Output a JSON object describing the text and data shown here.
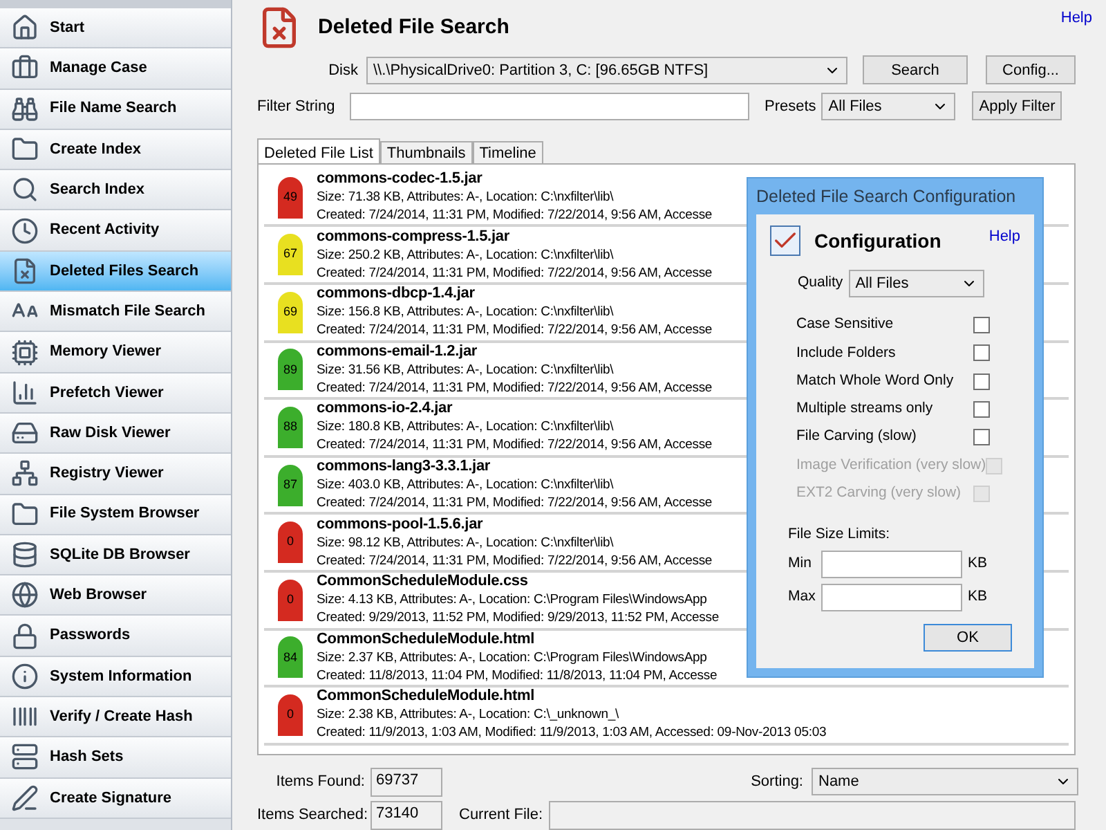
{
  "sidebar": {
    "items": [
      {
        "label": "Start",
        "selected": false
      },
      {
        "label": "Manage Case",
        "selected": false
      },
      {
        "label": "File Name Search",
        "selected": false
      },
      {
        "label": "Create Index",
        "selected": false
      },
      {
        "label": "Search Index",
        "selected": false
      },
      {
        "label": "Recent Activity",
        "selected": false
      },
      {
        "label": "Deleted Files Search",
        "selected": true
      },
      {
        "label": "Mismatch File Search",
        "selected": false
      },
      {
        "label": "Memory Viewer",
        "selected": false
      },
      {
        "label": "Prefetch Viewer",
        "selected": false
      },
      {
        "label": "Raw Disk Viewer",
        "selected": false
      },
      {
        "label": "Registry Viewer",
        "selected": false
      },
      {
        "label": "File System Browser",
        "selected": false
      },
      {
        "label": "SQLite DB Browser",
        "selected": false
      },
      {
        "label": "Web Browser",
        "selected": false
      },
      {
        "label": "Passwords",
        "selected": false
      },
      {
        "label": "System Information",
        "selected": false
      },
      {
        "label": "Verify / Create Hash",
        "selected": false
      },
      {
        "label": "Hash Sets",
        "selected": false
      },
      {
        "label": "Create Signature",
        "selected": false
      }
    ]
  },
  "header": {
    "title": "Deleted File Search",
    "help": "Help"
  },
  "disk": {
    "label": "Disk",
    "value": "\\\\.\\PhysicalDrive0: Partition 3, C: [96.65GB NTFS]"
  },
  "filter": {
    "label": "Filter String"
  },
  "presets": {
    "label": "Presets",
    "value": "All Files"
  },
  "buttons": {
    "search": "Search",
    "config": "Config...",
    "apply": "Apply Filter"
  },
  "tabs": [
    {
      "label": "Deleted File List",
      "selected": true
    },
    {
      "label": "Thumbnails",
      "selected": false
    },
    {
      "label": "Timeline",
      "selected": false
    }
  ],
  "files": [
    {
      "score": "49",
      "color": "#d42a20",
      "name": "commons-codec-1.5.jar",
      "line1": "Size: 71.38 KB, Attributes: A-, Location: C:\\nxfilter\\lib\\",
      "line2": "Created: 7/24/2014, 11:31 PM, Modified: 7/22/2014, 9:56 AM, Accesse"
    },
    {
      "score": "67",
      "color": "#e8e020",
      "name": "commons-compress-1.5.jar",
      "line1": "Size: 250.2 KB, Attributes: A-, Location: C:\\nxfilter\\lib\\",
      "line2": "Created: 7/24/2014, 11:31 PM, Modified: 7/22/2014, 9:56 AM, Accesse"
    },
    {
      "score": "69",
      "color": "#e8e020",
      "name": "commons-dbcp-1.4.jar",
      "line1": "Size: 156.8 KB, Attributes: A-, Location: C:\\nxfilter\\lib\\",
      "line2": "Created: 7/24/2014, 11:31 PM, Modified: 7/22/2014, 9:56 AM, Accesse"
    },
    {
      "score": "89",
      "color": "#3cae2c",
      "name": "commons-email-1.2.jar",
      "line1": "Size: 31.56 KB, Attributes: A-, Location: C:\\nxfilter\\lib\\",
      "line2": "Created: 7/24/2014, 11:31 PM, Modified: 7/22/2014, 9:56 AM, Accesse"
    },
    {
      "score": "88",
      "color": "#3cae2c",
      "name": "commons-io-2.4.jar",
      "line1": "Size: 180.8 KB, Attributes: A-, Location: C:\\nxfilter\\lib\\",
      "line2": "Created: 7/24/2014, 11:31 PM, Modified: 7/22/2014, 9:56 AM, Accesse"
    },
    {
      "score": "87",
      "color": "#3cae2c",
      "name": "commons-lang3-3.3.1.jar",
      "line1": "Size: 403.0 KB, Attributes: A-, Location: C:\\nxfilter\\lib\\",
      "line2": "Created: 7/24/2014, 11:31 PM, Modified: 7/22/2014, 9:56 AM, Accesse"
    },
    {
      "score": "0",
      "color": "#d42a20",
      "name": "commons-pool-1.5.6.jar",
      "line1": "Size: 98.12 KB, Attributes: A-, Location: C:\\nxfilter\\lib\\",
      "line2": "Created: 7/24/2014, 11:31 PM, Modified: 7/22/2014, 9:56 AM, Accesse"
    },
    {
      "score": "0",
      "color": "#d42a20",
      "name": "CommonScheduleModule.css",
      "line1": "Size: 4.13 KB, Attributes: A-, Location: C:\\Program Files\\WindowsApp",
      "line2": "Created: 9/29/2013, 11:52 PM, Modified: 9/29/2013, 11:52 PM, Accesse"
    },
    {
      "score": "84",
      "color": "#3cae2c",
      "name": "CommonScheduleModule.html",
      "line1": "Size: 2.37 KB, Attributes: A-, Location: C:\\Program Files\\WindowsApp",
      "line2": "Created: 11/8/2013, 11:04 PM, Modified: 11/8/2013, 11:04 PM, Accesse"
    },
    {
      "score": "0",
      "color": "#d42a20",
      "name": "CommonScheduleModule.html",
      "line1": "Size: 2.38 KB, Attributes: A-, Location: C:\\_unknown_\\",
      "line2": "Created: 11/9/2013, 1:03 AM, Modified: 11/9/2013, 1:03 AM, Accessed: 09-Nov-2013 05:03"
    }
  ],
  "status": {
    "found_label": "Items Found:",
    "found": "69737",
    "searched_label": "Items Searched:",
    "searched": "73140",
    "current_label": "Current File:",
    "sorting_label": "Sorting:",
    "sorting": "Name"
  },
  "dialog": {
    "title": "Deleted File Search Configuration",
    "heading": "Configuration",
    "help": "Help",
    "quality_label": "Quality",
    "quality": "All Files",
    "options": [
      {
        "label": "Case Sensitive",
        "checked": false,
        "disabled": false
      },
      {
        "label": "Include Folders",
        "checked": false,
        "disabled": false
      },
      {
        "label": "Match Whole Word Only",
        "checked": false,
        "disabled": false
      },
      {
        "label": "Multiple streams only",
        "checked": false,
        "disabled": false
      },
      {
        "label": "File Carving (slow)",
        "checked": false,
        "disabled": false
      },
      {
        "label": "Image Verification (very slow)",
        "checked": false,
        "disabled": true
      },
      {
        "label": "EXT2 Carving (very slow)",
        "checked": false,
        "disabled": true
      }
    ],
    "limits_label": "File Size Limits:",
    "min_label": "Min",
    "max_label": "Max",
    "unit_min": "KB",
    "unit_max": "KB",
    "ok": "OK"
  }
}
